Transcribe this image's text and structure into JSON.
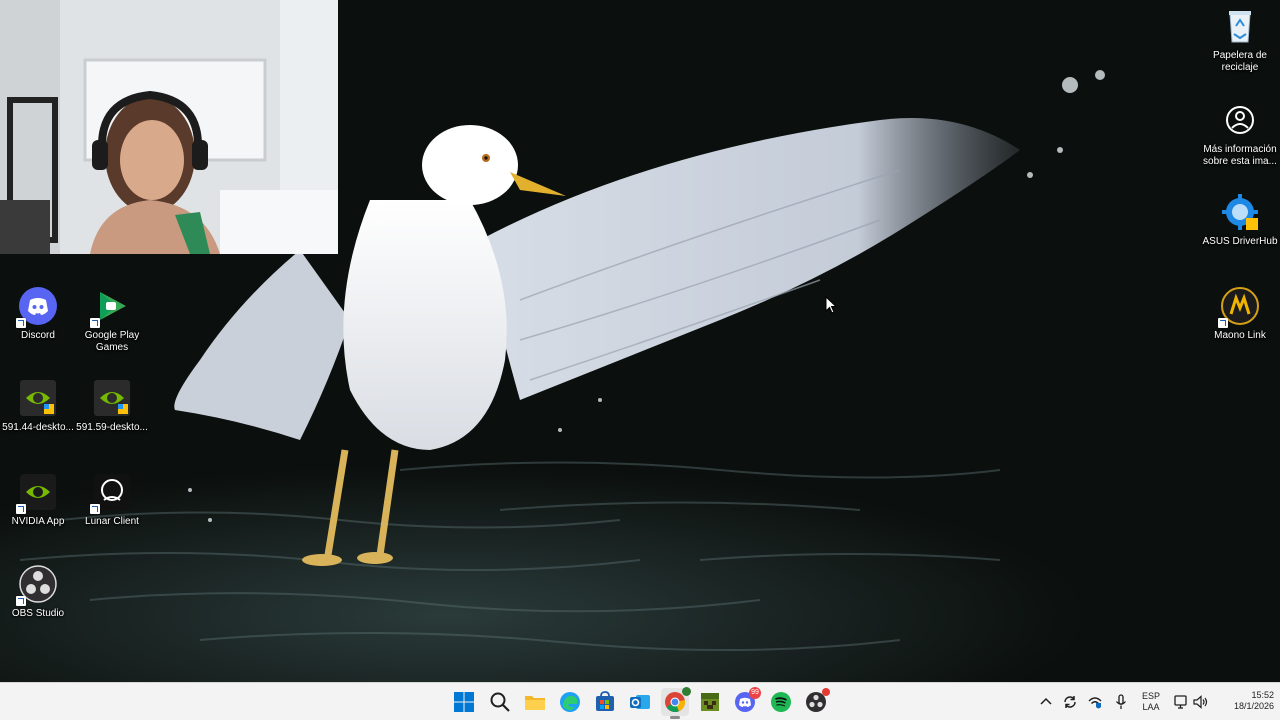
{
  "desktop": {
    "wallpaper": "seagull-spreading-wings-on-water",
    "icons_left": [
      {
        "label": "Discord",
        "icon": "discord-icon"
      },
      {
        "label": "Google Play Games",
        "icon": "google-play-games-icon"
      },
      {
        "label": "591.44-deskto...",
        "icon": "nvidia-installer-icon"
      },
      {
        "label": "591.59-deskto...",
        "icon": "nvidia-installer-icon"
      },
      {
        "label": "NVIDIA App",
        "icon": "nvidia-app-icon"
      },
      {
        "label": "Lunar Client",
        "icon": "lunar-client-icon"
      },
      {
        "label": "OBS Studio",
        "icon": "obs-studio-icon"
      }
    ],
    "icons_right": [
      {
        "label": "Papelera de reciclaje",
        "icon": "recycle-bin-icon"
      },
      {
        "label": "Más información sobre esta ima...",
        "icon": "spotlight-info-icon"
      },
      {
        "label": "ASUS DriverHub",
        "icon": "asus-driverhub-icon"
      },
      {
        "label": "Maono Link",
        "icon": "maono-link-icon"
      }
    ]
  },
  "webcam": {
    "description_icon": "webcam-overlay"
  },
  "taskbar": {
    "apps": [
      {
        "name": "Inicio",
        "icon": "windows-start-icon"
      },
      {
        "name": "Buscar",
        "icon": "search-icon"
      },
      {
        "name": "Explorador de archivos",
        "icon": "folder-icon"
      },
      {
        "name": "Microsoft Edge",
        "icon": "edge-icon"
      },
      {
        "name": "Microsoft Store",
        "icon": "store-icon"
      },
      {
        "name": "Outlook",
        "icon": "outlook-icon"
      },
      {
        "name": "Google Chrome",
        "icon": "chrome-icon"
      },
      {
        "name": "Minecraft",
        "icon": "minecraft-icon"
      },
      {
        "name": "Discord",
        "icon": "discord-icon",
        "badge": "99"
      },
      {
        "name": "Spotify",
        "icon": "spotify-icon"
      },
      {
        "name": "OBS Studio",
        "icon": "obs-studio-icon"
      }
    ],
    "tray": {
      "language": "ESP",
      "layout": "LAA",
      "time": "15:52",
      "date": "18/1/2026"
    }
  },
  "colors": {
    "discord": "#5865F2",
    "spotify": "#1DB954",
    "nvidia": "#76B900",
    "windows": "#0078D4",
    "taskbar": "#F3F3F3"
  }
}
